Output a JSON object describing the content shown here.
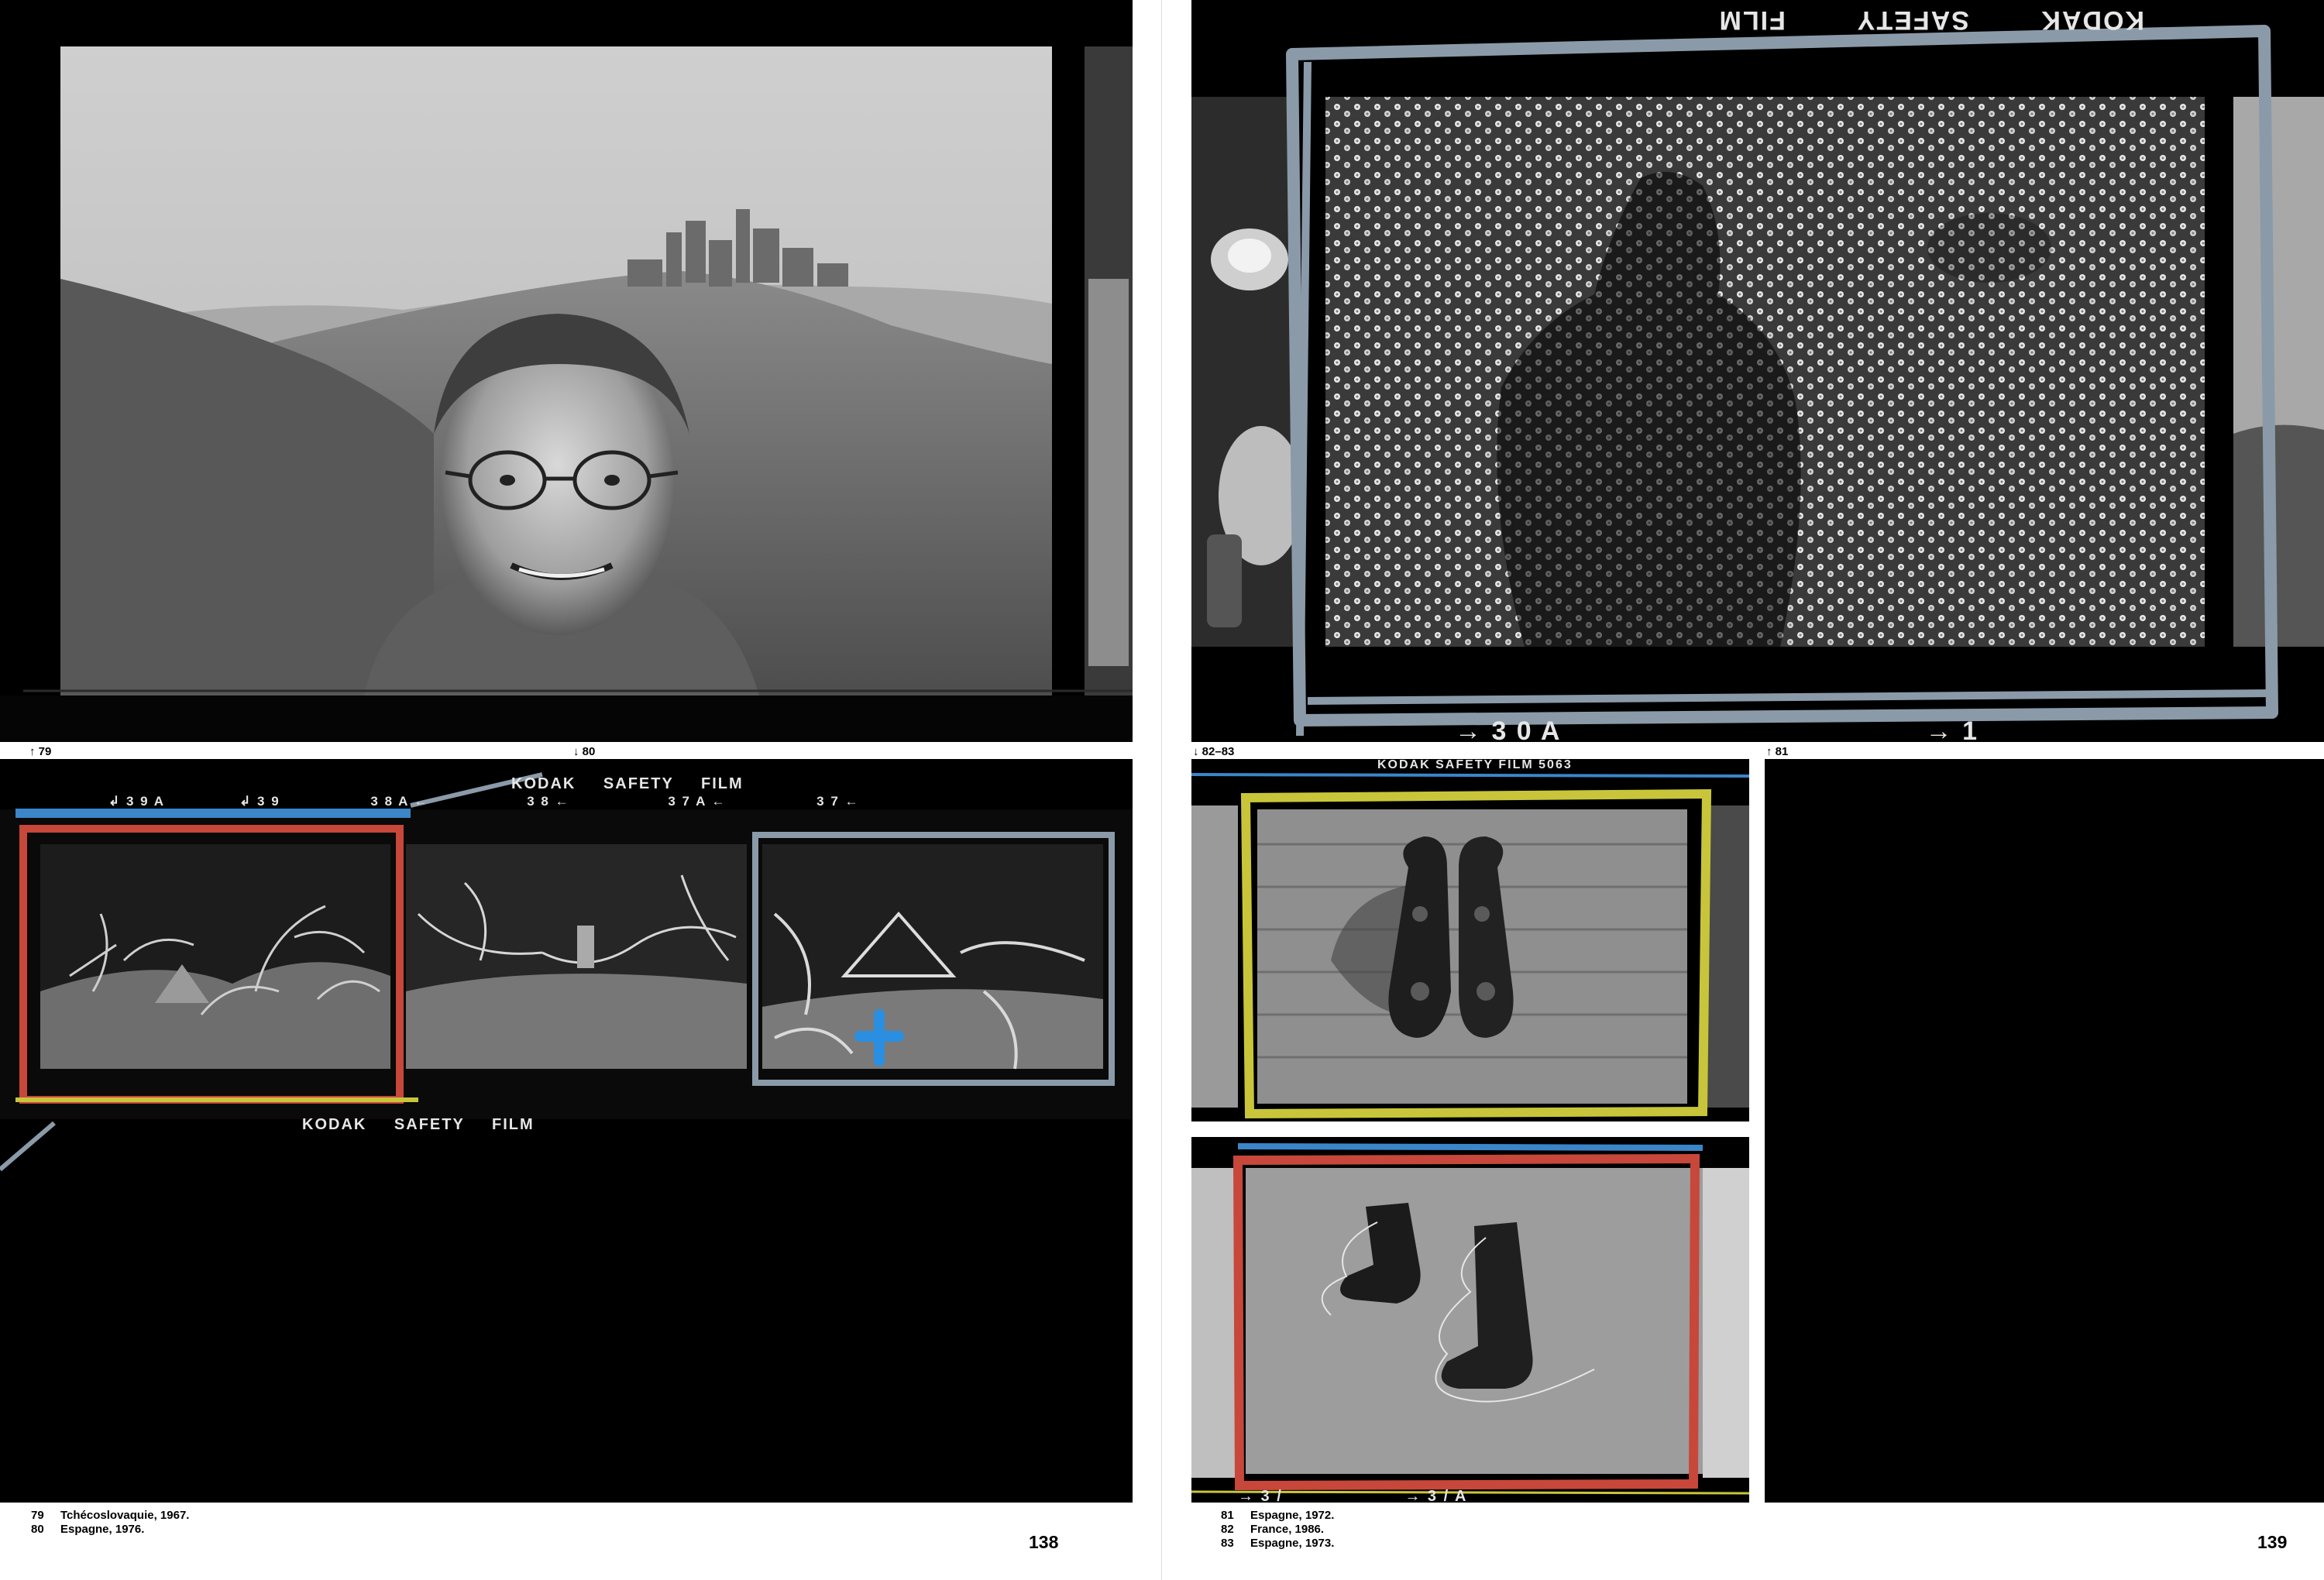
{
  "spread": {
    "left_page": {
      "folio": "138",
      "markers": {
        "top_photo": "↑ 79",
        "strip": "↓ 80"
      },
      "strip_edge_text": [
        "KODAK",
        "SAFETY",
        "FILM"
      ],
      "strip_bottom_text": [
        "KODAK",
        "SAFETY",
        "FILM"
      ],
      "strip_frame_numbers": [
        "↲ 3 9 A",
        "↲ 3 9",
        "3 8 A ←",
        "3 8 ←",
        "3 7 A ←",
        "3 7 ←"
      ],
      "captions": [
        {
          "num": "79",
          "text": "Tchécoslovaquie, 1967."
        },
        {
          "num": "80",
          "text": "Espagne, 1976."
        }
      ]
    },
    "right_page": {
      "folio": "139",
      "markers": {
        "left": "↓ 82–83",
        "right": "↑ 81"
      },
      "top_edge_text": [
        "KODAK",
        "SAFETY",
        "FILM"
      ],
      "bottom_frame_numbers": [
        "→ 3 0 A",
        "→ 1"
      ],
      "strip2_edge_text": "KODAK SAFETY FILM 5063",
      "strip3_frame_numbers": [
        "→ 3 /",
        "→ 3 / A"
      ],
      "captions": [
        {
          "num": "81",
          "text": "Espagne, 1972."
        },
        {
          "num": "82",
          "text": "France, 1986."
        },
        {
          "num": "83",
          "text": "Espagne, 1973."
        }
      ]
    }
  },
  "colors": {
    "film_black": "#000000",
    "grease_red": "#c7473a",
    "grease_yellow": "#c9c53a",
    "grease_blue": "#3a86c9",
    "grease_grey": "#8a9aa8",
    "cross_blue": "#2a8fe0"
  },
  "icons": [
    "arrow-up-icon",
    "arrow-down-icon"
  ]
}
